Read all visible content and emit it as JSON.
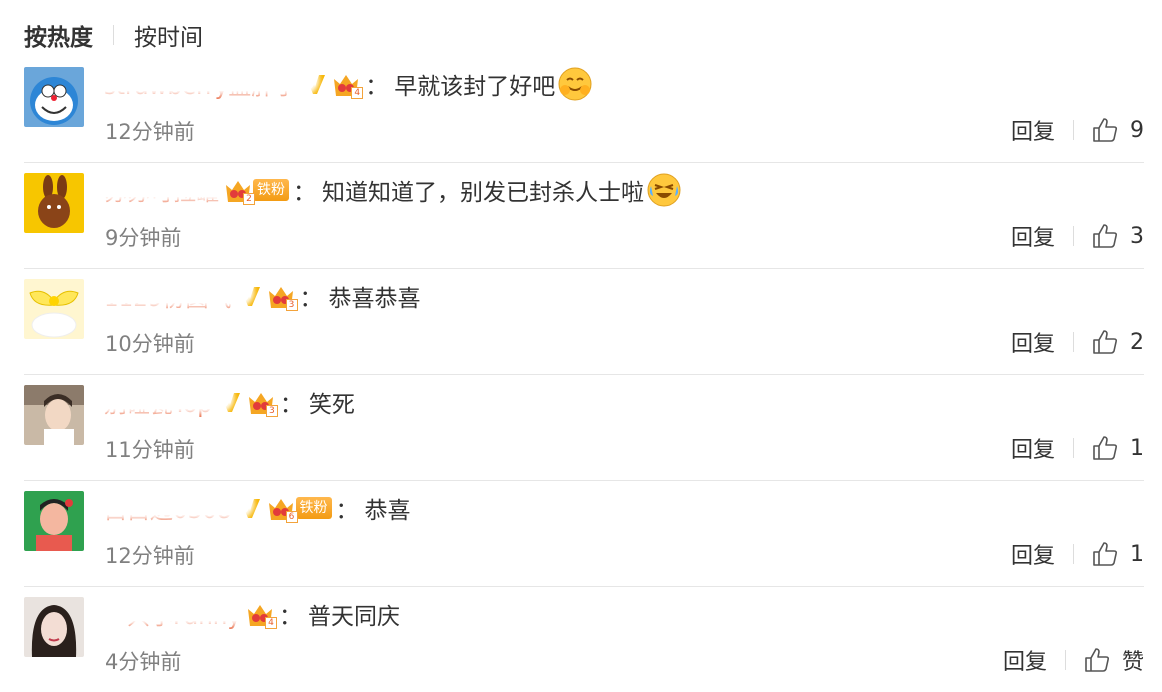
{
  "sort": {
    "hot_label": "按热度",
    "time_label": "按时间"
  },
  "reply_label": "回复",
  "comments": [
    {
      "username": "strawberry蓝胖子",
      "verified": true,
      "crown_level": "4",
      "fan_badge": "",
      "text": "早就该封了好吧",
      "emoji": "hug-emoji",
      "time": "12分钟前",
      "likes": "9"
    },
    {
      "username": "苏苏可拉罐",
      "verified": false,
      "crown_level": "2",
      "fan_badge": "铁粉",
      "text": "知道知道了，别发已封杀人士啦",
      "emoji": "laugh-cry-emoji",
      "time": "9分钟前",
      "likes": "3"
    },
    {
      "username": "1129份圆气",
      "verified": true,
      "crown_level": "3",
      "fan_badge": "",
      "text": "恭喜恭喜",
      "emoji": "",
      "time": "10分钟前",
      "likes": "2"
    },
    {
      "username": "别碰瓷Top",
      "verified": true,
      "crown_level": "3",
      "fan_badge": "",
      "text": "笑死",
      "emoji": "",
      "time": "11分钟前",
      "likes": "1"
    },
    {
      "username": "白白边0308",
      "verified": true,
      "crown_level": "6",
      "fan_badge": "铁粉",
      "text": "恭喜",
      "emoji": "",
      "time": "12分钟前",
      "likes": "1"
    },
    {
      "username": "一只小Fanny",
      "verified": false,
      "crown_level": "4",
      "fan_badge": "",
      "text": "普天同庆",
      "emoji": "",
      "time": "4分钟前",
      "likes": "赞"
    }
  ],
  "colors": {
    "username": "#eb7350",
    "verified": "#f7b500",
    "crown": "#f5a623",
    "fan_badge": "#f39b13"
  },
  "icons": {
    "like": "thumbs-up-icon",
    "verified": "verified-v-icon",
    "crown": "crown-icon"
  }
}
